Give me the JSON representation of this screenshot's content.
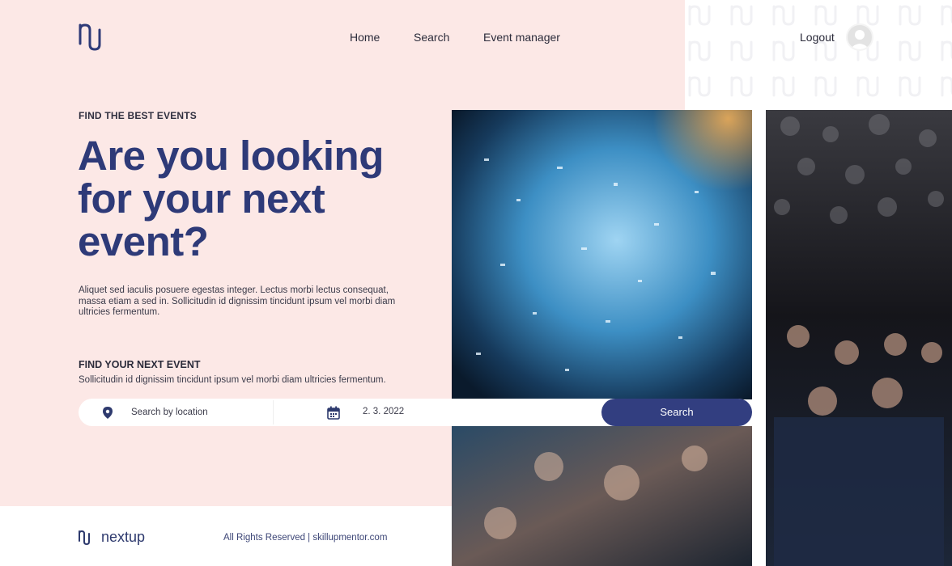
{
  "brand": {
    "name": "nextup",
    "logo_icon": "nu-logo-icon",
    "color": "#2e3a78"
  },
  "nav": {
    "home": "Home",
    "search": "Search",
    "event_manager": "Event manager"
  },
  "user": {
    "logout": "Logout",
    "avatar_icon": "user-avatar-icon"
  },
  "hero": {
    "eyebrow": "FIND THE BEST EVENTS",
    "headline": [
      "Are you looking",
      "for your next",
      "event?"
    ],
    "description": "Aliquet sed iaculis posuere egestas integer. Lectus morbi lectus consequat, massa etiam a sed in. Sollicitudin id dignissim tincidunt ipsum vel morbi diam  ultricies fermentum."
  },
  "finder": {
    "title": "FIND YOUR NEXT EVENT",
    "subtitle": "Sollicitudin id dignissim tincidunt ipsum vel morbi diam  ultricies fermentum.",
    "location_placeholder": "Search by location",
    "location_icon": "location-pin-icon",
    "date_icon": "calendar-icon",
    "date_value": "2. 3. 2022",
    "search_button": "Search"
  },
  "footer": {
    "copyright": "All Rights Reserved | skillupmentor.com"
  },
  "colors": {
    "background": "#fce8e6",
    "accent": "#323e80"
  }
}
